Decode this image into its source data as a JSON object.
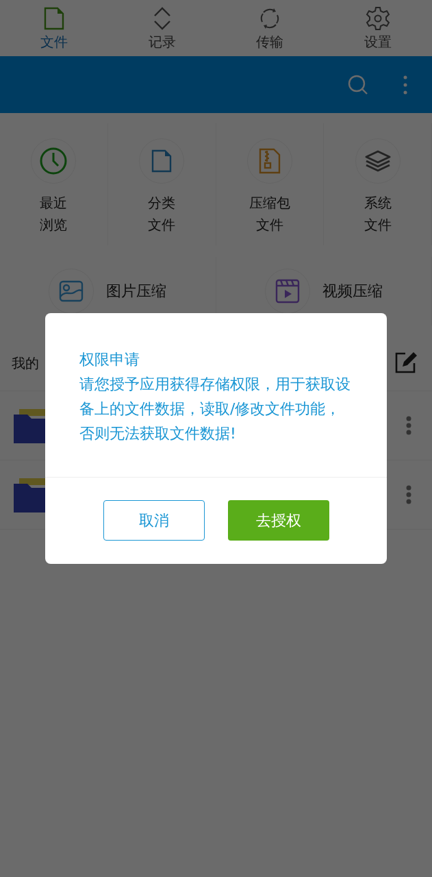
{
  "tabs": [
    {
      "label": "文件",
      "kind": "file",
      "selected": true
    },
    {
      "label": "记录",
      "kind": "updown",
      "selected": false
    },
    {
      "label": "传输",
      "kind": "sync",
      "selected": false
    },
    {
      "label": "设置",
      "kind": "gear",
      "selected": false
    }
  ],
  "shortcuts": [
    {
      "kind": "clock",
      "lines": [
        "最近",
        "浏览"
      ]
    },
    {
      "kind": "file",
      "lines": [
        "分类",
        "文件"
      ]
    },
    {
      "kind": "zip",
      "lines": [
        "压缩包",
        "文件"
      ]
    },
    {
      "kind": "layers",
      "lines": [
        "系统",
        "文件"
      ]
    }
  ],
  "tools": [
    {
      "kind": "image",
      "label": "图片压缩"
    },
    {
      "kind": "video",
      "label": "视频压缩"
    }
  ],
  "my_files": {
    "title": "我的"
  },
  "folders": [
    {
      "kind": "folder"
    },
    {
      "kind": "folder"
    }
  ],
  "dialog": {
    "title": "权限申请",
    "message": "请您授予应用获得存储权限，用于获取设备上的文件数据，读取/修改文件功能，否则无法获取文件数据!",
    "buttons": [
      {
        "kind": "secondary",
        "label": "取消"
      },
      {
        "kind": "primary",
        "label": "去授权"
      }
    ]
  }
}
